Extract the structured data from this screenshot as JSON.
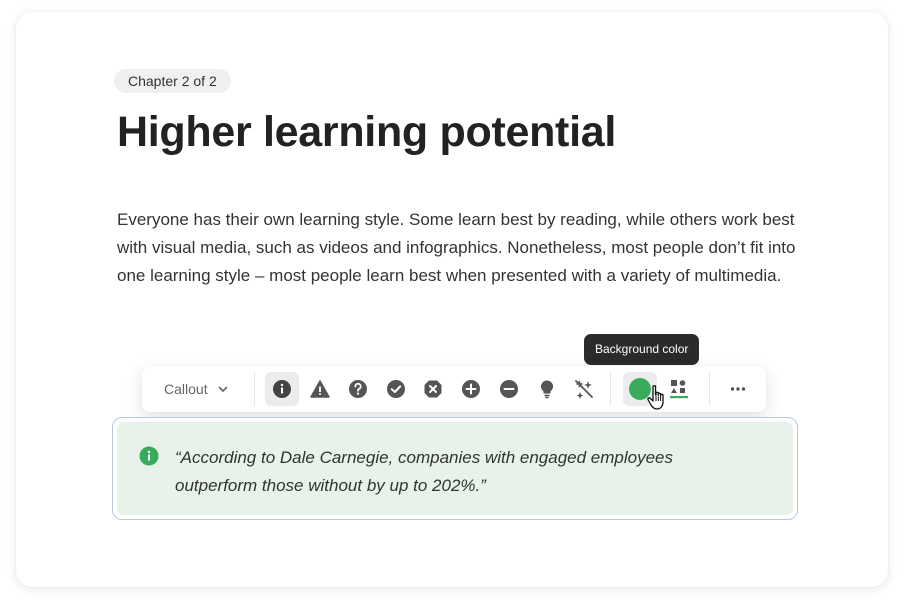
{
  "chapter_badge": "Chapter 2 of 2",
  "title": "Higher learning potential",
  "body_text": "Everyone has their own learning style. Some learn best by reading, while others work best with visual media, such as videos and infographics. Nonetheless, most people don’t fit into one learning style – most people learn best when presented with a variety of multimedia.",
  "toolbar": {
    "block_type_label": "Callout",
    "tooltip": "Background color",
    "icons": [
      "info-icon",
      "warning-icon",
      "question-icon",
      "check-icon",
      "cross-icon",
      "plus-icon",
      "minus-icon",
      "bulb-icon",
      "no-icon-icon"
    ],
    "selected_icon": "info-icon",
    "background_color": "#3aaa5c",
    "text_color_underline": "#3aaa5c"
  },
  "callout": {
    "text": "“According to Dale Carnegie, companies with engaged employees outperform those without by up to 202%.”",
    "icon": "info-icon",
    "icon_color": "#3aaa5c",
    "background": "#e6f2ea"
  }
}
